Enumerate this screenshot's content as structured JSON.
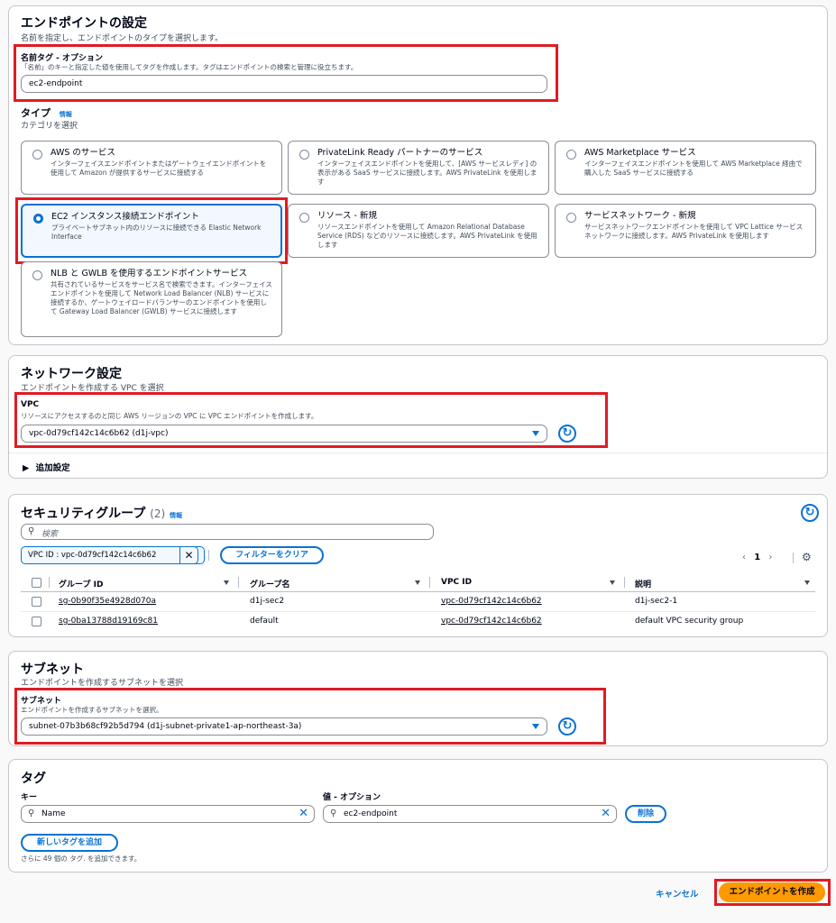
{
  "endpoint": {
    "title": "エンドポイントの設定",
    "desc": "名前を指定し、エンドポイントのタイプを選択します。",
    "name_tag_label": "名前タグ - オプション",
    "name_tag_desc": "「名前」のキーと指定した値を使用してタグを作成します。タグはエンドポイントの検索と管理に役立ちます。",
    "name_tag_value": "ec2-endpoint",
    "type_label": "タイプ",
    "type_info": "情報",
    "type_desc": "カテゴリを選択",
    "types": [
      {
        "title": "AWS のサービス",
        "desc": "インターフェイスエンドポイントまたはゲートウェイエンドポイントを使用して Amazon が提供するサービスに接続する",
        "selected": false
      },
      {
        "title": "PrivateLink Ready パートナーのサービス",
        "desc": "インターフェイスエンドポイントを使用して、[AWS サービスレディ] の表示がある SaaS サービスに接続します。AWS PrivateLink を使用します",
        "selected": false
      },
      {
        "title": "AWS Marketplace サービス",
        "desc": "インターフェイスエンドポイントを使用して AWS Marketplace 経由で購入した SaaS サービスに接続する",
        "selected": false
      },
      {
        "title": "EC2 インスタンス接続エンドポイント",
        "desc": "プライベートサブネット内のリソースに接続できる Elastic Network Interface",
        "selected": true
      },
      {
        "title": "リソース - 新規",
        "desc": "リソースエンドポイントを使用して Amazon Relational Database Service (RDS) などのリソースに接続します。AWS PrivateLink を使用します",
        "selected": false
      },
      {
        "title": "サービスネットワーク - 新規",
        "desc": "サービスネットワークエンドポイントを使用して VPC Lattice サービスネットワークに接続します。AWS PrivateLink を使用します",
        "selected": false
      },
      {
        "title": "NLB と GWLB を使用するエンドポイントサービス",
        "desc": "共有されているサービスをサービス名で検索できます。インターフェイスエンドポイントを使用して Network Load Balancer (NLB) サービスに接続するか、ゲートウェイロードバランサーのエンドポイントを使用して Gateway Load Balancer (GWLB) サービスに接続します",
        "selected": false
      }
    ]
  },
  "network": {
    "title": "ネットワーク設定",
    "desc": "エンドポイントを作成する VPC を選択",
    "vpc_label": "VPC",
    "vpc_desc": "リソースにアクセスするのと同じ AWS リージョンの VPC に VPC エンドポイントを作成します。",
    "vpc_value": "vpc-0d79cf142c14c6b62 (d1j-vpc)",
    "additional": "追加設定"
  },
  "sg": {
    "title": "セキュリティグループ",
    "count": "(2)",
    "info": "情報",
    "search_placeholder": "検索",
    "filter_token": "VPC ID : vpc-0d79cf142c14c6b62",
    "clear_filters": "フィルターをクリア",
    "page": "1",
    "columns": [
      "グループ ID",
      "グループ名",
      "VPC ID",
      "説明"
    ],
    "rows": [
      {
        "id": "sg-0b90f35e4928d070a",
        "name": "d1j-sec2",
        "vpc": "vpc-0d79cf142c14c6b62",
        "desc": "d1j-sec2-1"
      },
      {
        "id": "sg-0ba13788d19169c81",
        "name": "default",
        "vpc": "vpc-0d79cf142c14c6b62",
        "desc": "default VPC security group"
      }
    ]
  },
  "subnet": {
    "title": "サブネット",
    "desc": "エンドポイントを作成するサブネットを選択",
    "label": "サブネット",
    "label_desc": "エンドポイントを作成するサブネットを選択。",
    "value": "subnet-07b3b68cf92b5d794 (d1j-subnet-private1-ap-northeast-3a)"
  },
  "tags": {
    "title": "タグ",
    "key_label": "キー",
    "value_label": "値 - オプション",
    "key_value": "Name",
    "value_value": "ec2-endpoint",
    "remove": "削除",
    "add": "新しいタグを追加",
    "remaining": "さらに 49 個の タグ. を追加できます。"
  },
  "footer": {
    "cancel": "キャンセル",
    "create": "エンドポイントを作成"
  }
}
